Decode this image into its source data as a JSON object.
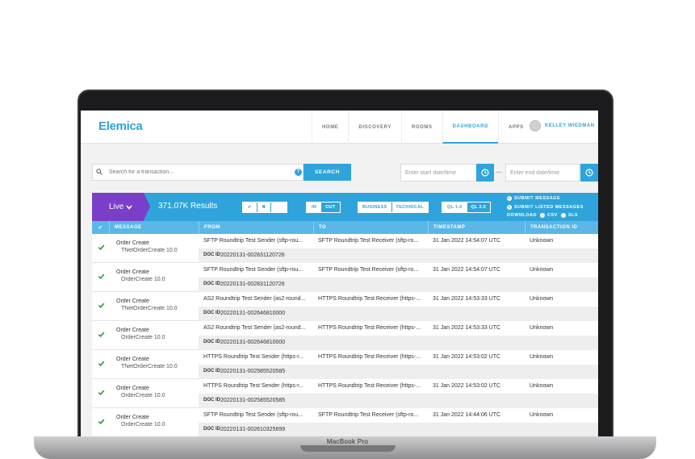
{
  "app": {
    "logo": "Elemica",
    "nav": [
      {
        "label": "HOME"
      },
      {
        "label": "DISCOVERY"
      },
      {
        "label": "ROOMS"
      },
      {
        "label": "DASHBOARD"
      },
      {
        "label": "APPS"
      }
    ],
    "active_nav": "DASHBOARD",
    "user_name": "KELLEY WIEDMAN"
  },
  "search": {
    "placeholder": "Search for a transaction...",
    "button_label": "SEARCH",
    "help_label": "?",
    "start_date_placeholder": "Enter start date/time",
    "end_date_placeholder": "Enter end date/time",
    "date_separator": "—"
  },
  "toolbar": {
    "live_label": "Live",
    "results_label": "371.07K Results",
    "status_filters": [
      "✔",
      "✖",
      "⁘"
    ],
    "direction_filters": [
      "IN",
      "OUT"
    ],
    "type_filters": [
      "BUSINESS",
      "TECHNICAL"
    ],
    "ql_filters": [
      "QL 1.0",
      "QL 2.0"
    ],
    "submit_message": "SUBMIT MESSAGE",
    "submit_listed": "SUBMIT LISTED MESSAGES",
    "download_label": "DOWNLOAD",
    "csv_label": "CSV",
    "xls_label": "XLS"
  },
  "table": {
    "headers": [
      "✔",
      "MESSAGE",
      "FROM",
      "TO",
      "TIMESTAMP",
      "TRANSACTION ID"
    ],
    "doc_id_label": "DOC ID",
    "rows": [
      {
        "title": "Order Create",
        "sub": "TNetOrderCreate 10.0",
        "from": "SFTP Roundtrip Test Sender (sftp-rou...",
        "to": "SFTP Roundtrip Test Receiver (sftp-ro...",
        "timestamp": "31 Jan 2022 14:54:07 UTC",
        "txid": "Unknown",
        "doc_id": "20220131-002831120726"
      },
      {
        "title": "Order Create",
        "sub": "OrderCreate 10.0",
        "from": "SFTP Roundtrip Test Sender (sftp-rou...",
        "to": "SFTP Roundtrip Test Receiver (sftp-ro...",
        "timestamp": "31 Jan 2022 14:54:07 UTC",
        "txid": "Unknown",
        "doc_id": "20220131-002831120726"
      },
      {
        "title": "Order Create",
        "sub": "TNetOrderCreate 10.0",
        "from": "AS2 Roundtrip Test Sender (as2-round...",
        "to": "HTTPS Roundtrip Test Receiver (https-...",
        "timestamp": "31 Jan 2022 14:53:33 UTC",
        "txid": "Unknown",
        "doc_id": "20220131-002646810000"
      },
      {
        "title": "Order Create",
        "sub": "OrderCreate 10.0",
        "from": "AS2 Roundtrip Test Sender (as2-round...",
        "to": "HTTPS Roundtrip Test Receiver (https-...",
        "timestamp": "31 Jan 2022 14:53:33 UTC",
        "txid": "Unknown",
        "doc_id": "20220131-002646810000"
      },
      {
        "title": "Order Create",
        "sub": "TNetOrderCreate 10.0",
        "from": "HTTPS Roundtrip Test Sender (https-r...",
        "to": "HTTPS Roundtrip Test Receiver (https-...",
        "timestamp": "31 Jan 2022 14:53:02 UTC",
        "txid": "Unknown",
        "doc_id": "20220131-002585520585"
      },
      {
        "title": "Order Create",
        "sub": "OrderCreate 10.0",
        "from": "HTTPS Roundtrip Test Sender (https-r...",
        "to": "HTTPS Roundtrip Test Receiver (https-...",
        "timestamp": "31 Jan 2022 14:53:02 UTC",
        "txid": "Unknown",
        "doc_id": "20220131-002585520585"
      },
      {
        "title": "Order Create",
        "sub": "OrderCreate 10.0",
        "from": "SFTP Roundtrip Test Sender (sftp-rou...",
        "to": "SFTP Roundtrip Test Receiver (sftp-ro...",
        "timestamp": "31 Jan 2022 14:44:06 UTC",
        "txid": "Unknown",
        "doc_id": "20220131-002610325699"
      }
    ]
  },
  "device": {
    "label": "MacBook Pro"
  },
  "colors": {
    "accent": "#2fa4db",
    "live": "#7a3fc8",
    "check": "#2a9d3a"
  }
}
